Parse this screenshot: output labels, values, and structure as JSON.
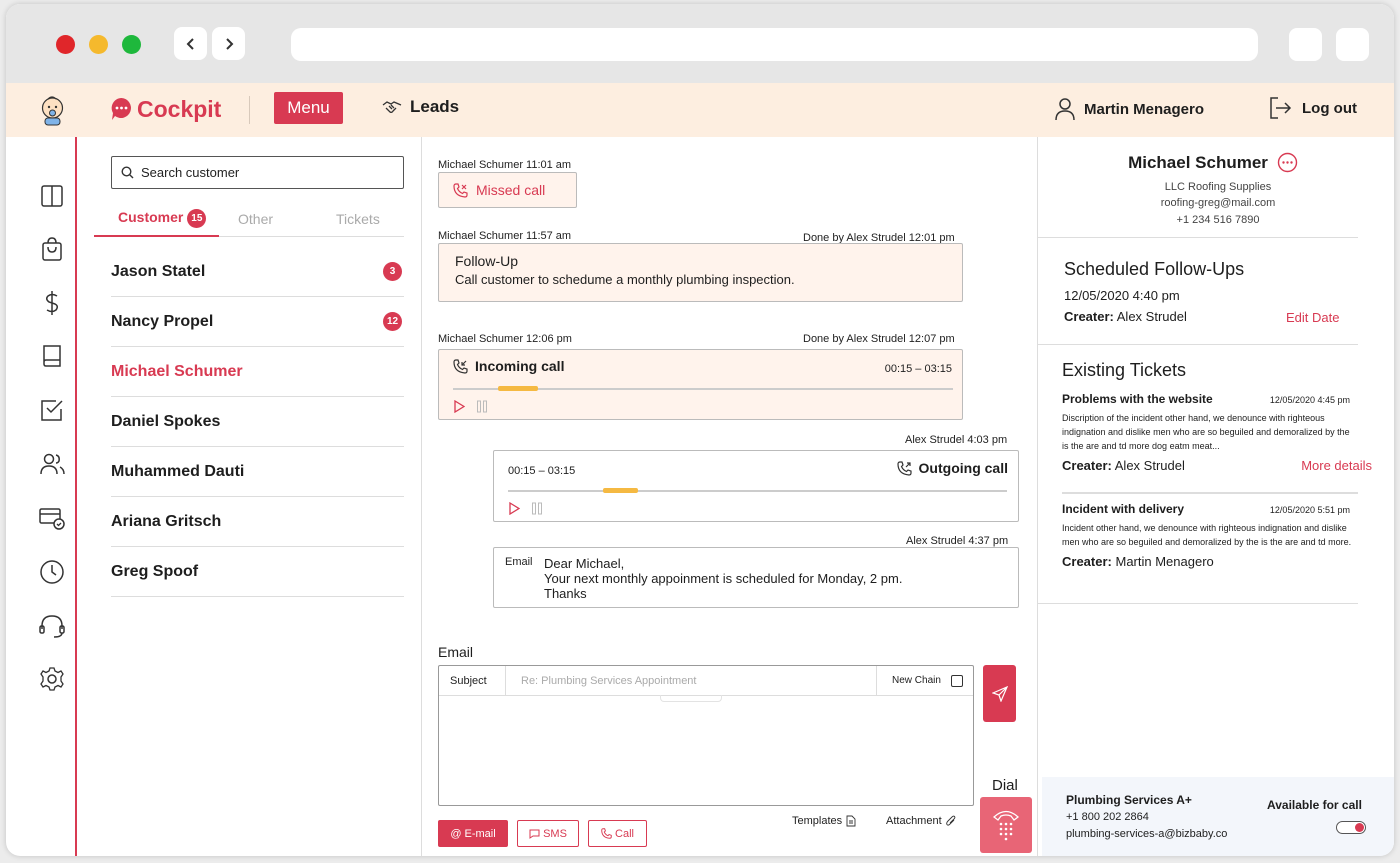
{
  "app": {
    "name": "Cockpit",
    "menu_label": "Menu",
    "leads_label": "Leads",
    "user_name": "Martin Menagero",
    "logout_label": "Log out"
  },
  "colors": {
    "brand": "#d83a52",
    "header_bg": "#fdeee0",
    "card_bg": "#fff3ec",
    "progress": "#f5b942"
  },
  "sidebar_icons": [
    "layout-icon",
    "shopping-bag-icon",
    "dollar-icon",
    "book-icon",
    "checkbox-icon",
    "users-icon",
    "billing-icon",
    "clock-icon",
    "headset-icon",
    "settings-icon"
  ],
  "customers": {
    "search_placeholder": "Search customer",
    "tabs": [
      {
        "label": "Customer",
        "badge": "15"
      },
      {
        "label": "Other"
      },
      {
        "label": "Tickets"
      }
    ],
    "list": [
      {
        "name": "Jason Statel",
        "badge": "3"
      },
      {
        "name": "Nancy Propel",
        "badge": "12"
      },
      {
        "name": "Michael Schumer",
        "active": true
      },
      {
        "name": "Daniel Spokes"
      },
      {
        "name": "Muhammed Dauti"
      },
      {
        "name": "Ariana Gritsch"
      },
      {
        "name": "Greg Spoof"
      }
    ]
  },
  "conversation": {
    "missed": {
      "meta": "Michael Schumer  11:01 am",
      "label": "Missed call"
    },
    "followup": {
      "meta_left": "Michael Schumer  11:57 am",
      "meta_right": "Done by Alex Strudel  12:01 pm",
      "title": "Follow-Up",
      "desc": "Call customer to schedume a monthly plumbing inspection."
    },
    "incoming": {
      "meta_left": "Michael Schumer  12:06 pm",
      "meta_right": "Done by Alex Strudel  12:07 pm",
      "title": "Incoming call",
      "time": "00:15 – 03:15",
      "progress_from": 0.09,
      "progress_to": 0.17
    },
    "outgoing": {
      "meta": "Alex Strudel  4:03 pm",
      "title": "Outgoing call",
      "time": "00:15 – 03:15",
      "progress_from": 0.19,
      "progress_to": 0.26
    },
    "email_msg": {
      "meta": "Alex Strudel  4:37 pm",
      "tag": "Email",
      "line1": "Dear Michael,",
      "line2": "Your next monthly appoinment is scheduled for Monday, 2 pm.",
      "line3": "Thanks"
    },
    "compose": {
      "label": "Email",
      "subject_label": "Subject",
      "subject_placeholder": "Re: Plumbing Services Appointment",
      "new_chain_label": "New Chain",
      "dial_label": "Dial",
      "channels": [
        "E-mail",
        "SMS",
        "Call"
      ],
      "templates_label": "Templates",
      "attachment_label": "Attachment"
    }
  },
  "contact": {
    "name": "Michael Schumer",
    "company": "LLC Roofing Supplies",
    "email": "roofing-greg@mail.com",
    "phone": "+1 234 516 7890"
  },
  "followups": {
    "heading": "Scheduled Follow-Ups",
    "date": "12/05/2020 4:40 pm",
    "creater_label": "Creater:",
    "creater": "Alex Strudel",
    "edit_label": "Edit Date"
  },
  "tickets": {
    "heading": "Existing Tickets",
    "items": [
      {
        "title": "Problems with the website",
        "date": "12/05/2020 4:45 pm",
        "desc": "Discription of the incident other hand, we denounce with righteous indignation and dislike men who are so beguiled and demoralized by the is the are and td more dog eatm meat...",
        "creater_label": "Creater:",
        "creater": "Alex Strudel",
        "link": "More details"
      },
      {
        "title": "Incident with delivery",
        "date": "12/05/2020 5:51 pm",
        "desc": "Incident other hand, we denounce with righteous indignation and dislike men who are so beguiled and demoralized by the is the are and td more.",
        "creater_label": "Creater:",
        "creater": "Martin Menagero"
      }
    ]
  },
  "availability": {
    "company": "Plumbing Services A+",
    "phone": "+1 800 202 2864",
    "email": "plumbing-services-a@bizbaby.co",
    "label": "Available for call",
    "on": true
  }
}
